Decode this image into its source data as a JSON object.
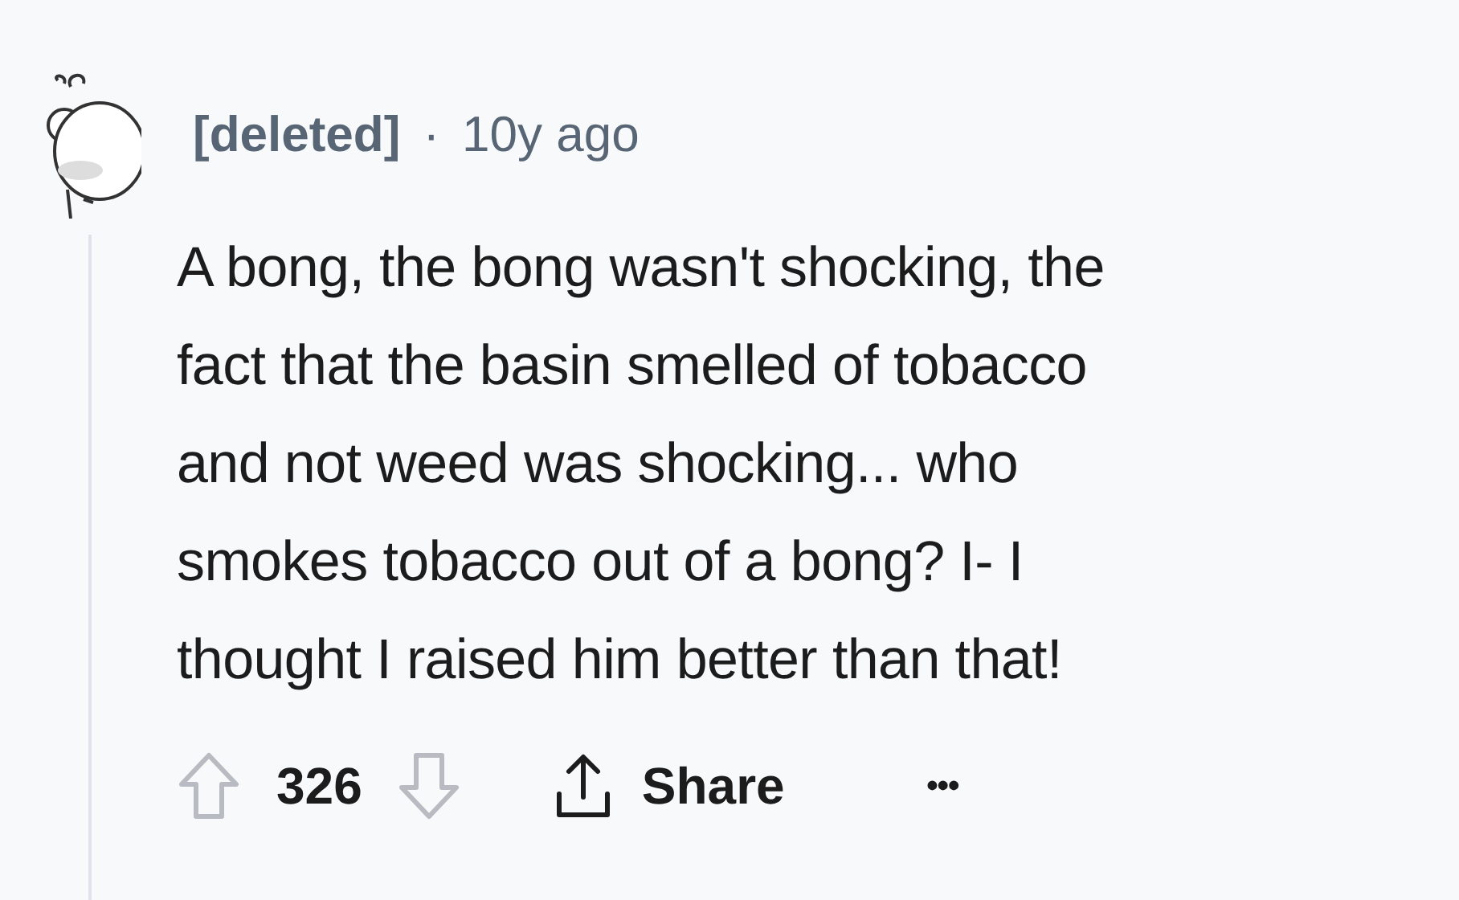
{
  "comment": {
    "author": "[deleted]",
    "separator": "·",
    "age": "10y ago",
    "body_lines": [
      "A bong, the bong wasn't shocking, the",
      "fact that the basin smelled of tobacco",
      "and not weed was shocking... who",
      "smokes tobacco out of a bong? I- I",
      "thought I raised him better than that!"
    ],
    "score": "326",
    "share": "Share",
    "more": "•••"
  }
}
